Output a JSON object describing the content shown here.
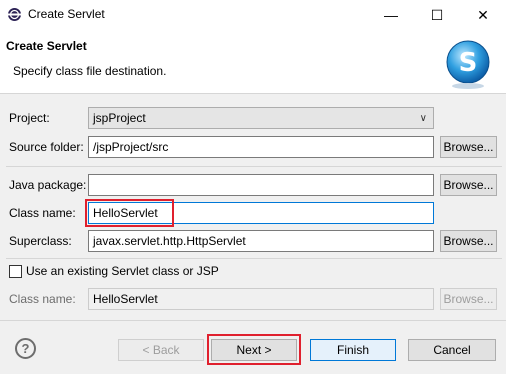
{
  "window": {
    "title": "Create Servlet",
    "minimize_symbol": "—",
    "maximize_symbol": "☐",
    "close_symbol": "✕"
  },
  "header": {
    "title": "Create Servlet",
    "subtitle": "Specify class file destination.",
    "logo_letter": "S"
  },
  "form": {
    "project_label": "Project:",
    "project_value": "jspProject",
    "source_folder_label": "Source folder:",
    "source_folder_value": "/jspProject/src",
    "java_package_label": "Java package:",
    "java_package_value": "",
    "class_name_label": "Class name:",
    "class_name_value": "HelloServlet",
    "superclass_label": "Superclass:",
    "superclass_value": "javax.servlet.http.HttpServlet",
    "existing_checkbox_label": "Use an existing Servlet class or JSP",
    "existing_checked": false,
    "existing_class_label": "Class name:",
    "existing_class_value": "HelloServlet",
    "browse_label": "Browse..."
  },
  "footer": {
    "help_symbol": "?",
    "back_label": "< Back",
    "next_label": "Next >",
    "finish_label": "Finish",
    "cancel_label": "Cancel"
  },
  "colors": {
    "highlight": "#e0202e",
    "focus": "#0078d7"
  }
}
